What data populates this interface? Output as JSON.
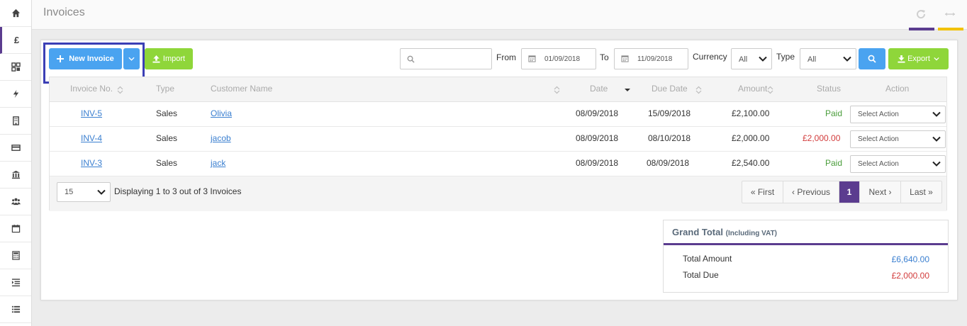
{
  "page": {
    "title": "Invoices"
  },
  "sidebar": {
    "items": [
      {
        "icon": "home-icon",
        "glyph": ""
      },
      {
        "icon": "pound-icon",
        "glyph": "£"
      },
      {
        "icon": "grid-icon",
        "glyph": ""
      },
      {
        "icon": "bolt-icon",
        "glyph": ""
      },
      {
        "icon": "building-icon",
        "glyph": ""
      },
      {
        "icon": "card-icon",
        "glyph": ""
      },
      {
        "icon": "bank-icon",
        "glyph": ""
      },
      {
        "icon": "users-icon",
        "glyph": ""
      },
      {
        "icon": "calendar-icon",
        "glyph": ""
      },
      {
        "icon": "calculator-icon",
        "glyph": ""
      },
      {
        "icon": "indent-icon",
        "glyph": ""
      },
      {
        "icon": "list-icon",
        "glyph": ""
      }
    ]
  },
  "toolbar": {
    "new_invoice_label": "New Invoice",
    "import_label": "Import",
    "search_placeholder": "",
    "from_label": "From",
    "from_date": "01/09/2018",
    "to_label": "To",
    "to_date": "11/09/2018",
    "currency_label": "Currency",
    "currency_value": "All",
    "type_label": "Type",
    "type_value": "All",
    "export_label": "Export"
  },
  "table": {
    "headers": {
      "invoice_no": "Invoice No.",
      "type": "Type",
      "customer": "Customer Name",
      "date": "Date",
      "due_date": "Due Date",
      "amount": "Amount",
      "status": "Status",
      "action": "Action"
    },
    "rows": [
      {
        "invoice_no": "INV-5",
        "type": "Sales",
        "customer": "Olivia",
        "date": "08/09/2018",
        "due_date": "15/09/2018",
        "amount": "£2,100.00",
        "status": "Paid",
        "action": "Select Action"
      },
      {
        "invoice_no": "INV-4",
        "type": "Sales",
        "customer": "jacob",
        "date": "08/09/2018",
        "due_date": "08/10/2018",
        "amount": "£2,000.00",
        "status": "£2,000.00",
        "action": "Select Action"
      },
      {
        "invoice_no": "INV-3",
        "type": "Sales",
        "customer": "jack",
        "date": "08/09/2018",
        "due_date": "08/09/2018",
        "amount": "£2,540.00",
        "status": "Paid",
        "action": "Select Action"
      }
    ],
    "page_size": "15",
    "summary": "Displaying 1 to 3 out of 3 Invoices",
    "pagination": {
      "first": "« First",
      "previous": "‹ Previous",
      "current": "1",
      "next": "Next ›",
      "last": "Last »"
    }
  },
  "grand_total": {
    "title": "Grand Total",
    "subtitle": "(Including VAT)",
    "total_amount_label": "Total Amount",
    "total_amount": "£6,640.00",
    "total_due_label": "Total Due",
    "total_due": "£2,000.00"
  },
  "colors": {
    "accent": "#5b3c8f",
    "primary": "#4aa3f0",
    "success": "#8fd63a",
    "danger": "#d23c3c",
    "paid": "#4a9d3b",
    "highlight": "#3b3fb5",
    "header_line_yellow": "#f2c200"
  }
}
